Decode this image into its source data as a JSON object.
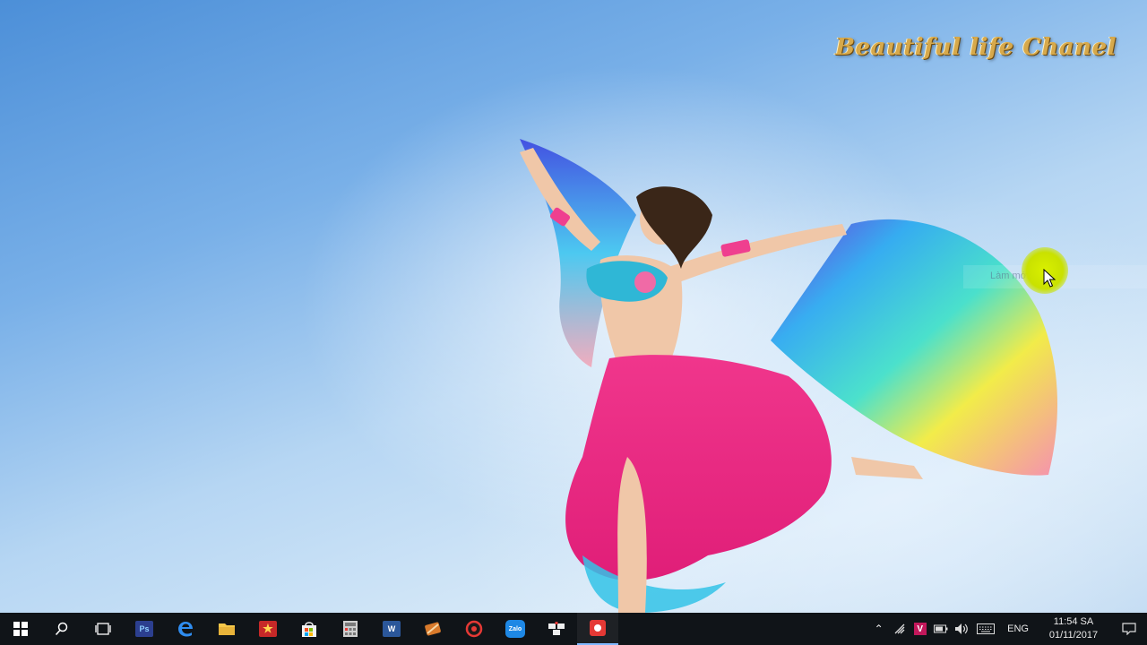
{
  "desktop": {
    "watermark_text": "Beautiful life Chanel",
    "tooltip_text": "Làm mới"
  },
  "taskbar": {
    "apps": [
      {
        "name": "start",
        "icon": "windows-logo-icon"
      },
      {
        "name": "search",
        "icon": "search-icon"
      },
      {
        "name": "task-view",
        "icon": "task-view-icon"
      },
      {
        "name": "photoshop",
        "icon": "photoshop-icon",
        "label": "Ps",
        "color": "#2c3f8f"
      },
      {
        "name": "edge",
        "icon": "edge-icon",
        "color": "#1e88e5"
      },
      {
        "name": "file-explorer",
        "icon": "folder-icon",
        "color": "#f2c14e"
      },
      {
        "name": "app-red-star",
        "icon": "red-star-icon",
        "color": "#c62828"
      },
      {
        "name": "store",
        "icon": "store-bag-icon",
        "color": "#ffffff"
      },
      {
        "name": "calculator-app",
        "icon": "calculator-icon",
        "color": "#bdbdbd"
      },
      {
        "name": "word",
        "icon": "word-icon",
        "label": "W",
        "color": "#2b579a"
      },
      {
        "name": "tool-app",
        "icon": "tool-icon",
        "color": "#d97a2b"
      },
      {
        "name": "media-app",
        "icon": "media-icon",
        "color": "#e53935"
      },
      {
        "name": "zalo",
        "icon": "zalo-icon",
        "label": "Zalo",
        "color": "#1e88e5"
      },
      {
        "name": "sketch-app",
        "icon": "sketch-icon",
        "color": "#eeeeee"
      },
      {
        "name": "recorder",
        "icon": "record-icon",
        "color": "#e53935"
      }
    ],
    "tray": {
      "language": "ENG",
      "time": "11:54 SA",
      "date": "01/11/2017"
    }
  }
}
